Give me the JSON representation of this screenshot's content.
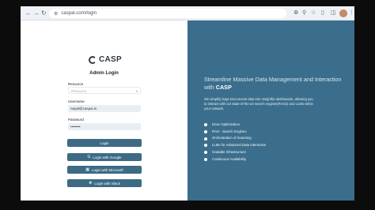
{
  "browser": {
    "url": "caspai.com/login",
    "icons": {
      "back": "arrow-left-icon",
      "forward": "arrow-right-icon",
      "reload": "reload-icon",
      "site_info": "site-info-icon"
    }
  },
  "brand": {
    "name": "CASP",
    "logo": "casp-logo"
  },
  "login": {
    "title": "Admin Login",
    "resource": {
      "label": "Resource",
      "placeholder": "Resource"
    },
    "username": {
      "label": "Username",
      "value": "nepal@caspai.in"
    },
    "password": {
      "label": "Password",
      "value": "••••••••"
    },
    "login_button": "Login",
    "google_button": "Login with Google",
    "microsoft_button": "Login with Microsoft",
    "slack_button": "Login with Slack"
  },
  "promo": {
    "headline_prefix": "Streamline Massive Data Management and Interaction with ",
    "headline_brand": "CASP",
    "description": "We simplify large Documents data into Insightful dashboards, allowing you to interact with our state-of-the-art search engines(RAGs) and LLMs within your network.",
    "features": [
      "Drive Optimization",
      "RAG - Search Engines",
      "Orchestration of Scanning",
      "LLMs for Advanced Data Interaction",
      "Scalable Infrastructure",
      "Continuous Availability"
    ]
  },
  "colors": {
    "accent": "#3D6A85",
    "panel": "#3B6E8C"
  }
}
